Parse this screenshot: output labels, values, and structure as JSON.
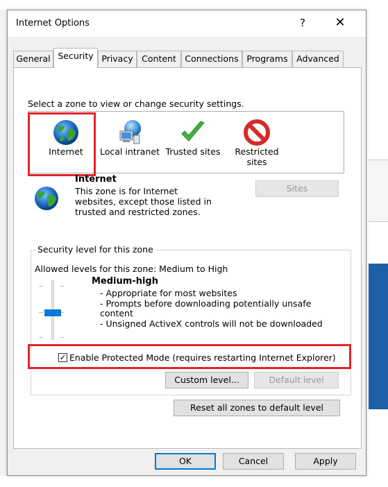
{
  "dialog": {
    "title": "Internet Options",
    "help_label": "?",
    "close_label": "✕"
  },
  "tabs": [
    {
      "label": "General"
    },
    {
      "label": "Security",
      "active": true
    },
    {
      "label": "Privacy"
    },
    {
      "label": "Content"
    },
    {
      "label": "Connections"
    },
    {
      "label": "Programs"
    },
    {
      "label": "Advanced"
    }
  ],
  "security": {
    "zone_prompt": "Select a zone to view or change security settings.",
    "zones": [
      {
        "label": "Internet",
        "icon": "globe-icon",
        "selected": true
      },
      {
        "label": "Local intranet",
        "icon": "network-globe-icon"
      },
      {
        "label": "Trusted sites",
        "icon": "checkmark-icon"
      },
      {
        "label": "Restricted sites",
        "icon": "prohibited-icon"
      }
    ],
    "zone_name": "Internet",
    "zone_description": "This zone is for Internet websites, except those listed in trusted and restricted zones.",
    "sites_button": "Sites",
    "group_legend": "Security level for this zone",
    "allowed_levels": "Allowed levels for this zone: Medium to High",
    "level_title": "Medium-high",
    "level_bullets": [
      "- Appropriate for most websites",
      "- Prompts before downloading potentially unsafe content",
      "- Unsigned ActiveX controls will not be downloaded"
    ],
    "protected_mode_label": "Enable Protected Mode (requires restarting Internet Explorer)",
    "protected_mode_checked": true,
    "custom_level_button": "Custom level...",
    "default_level_button": "Default level",
    "reset_all_button": "Reset all zones to default level"
  },
  "footer": {
    "ok": "OK",
    "cancel": "Cancel",
    "apply": "Apply"
  },
  "colors": {
    "highlight_red": "#e0242a",
    "slider_thumb": "#0078d7",
    "window_bg": "#f0f0f0"
  }
}
